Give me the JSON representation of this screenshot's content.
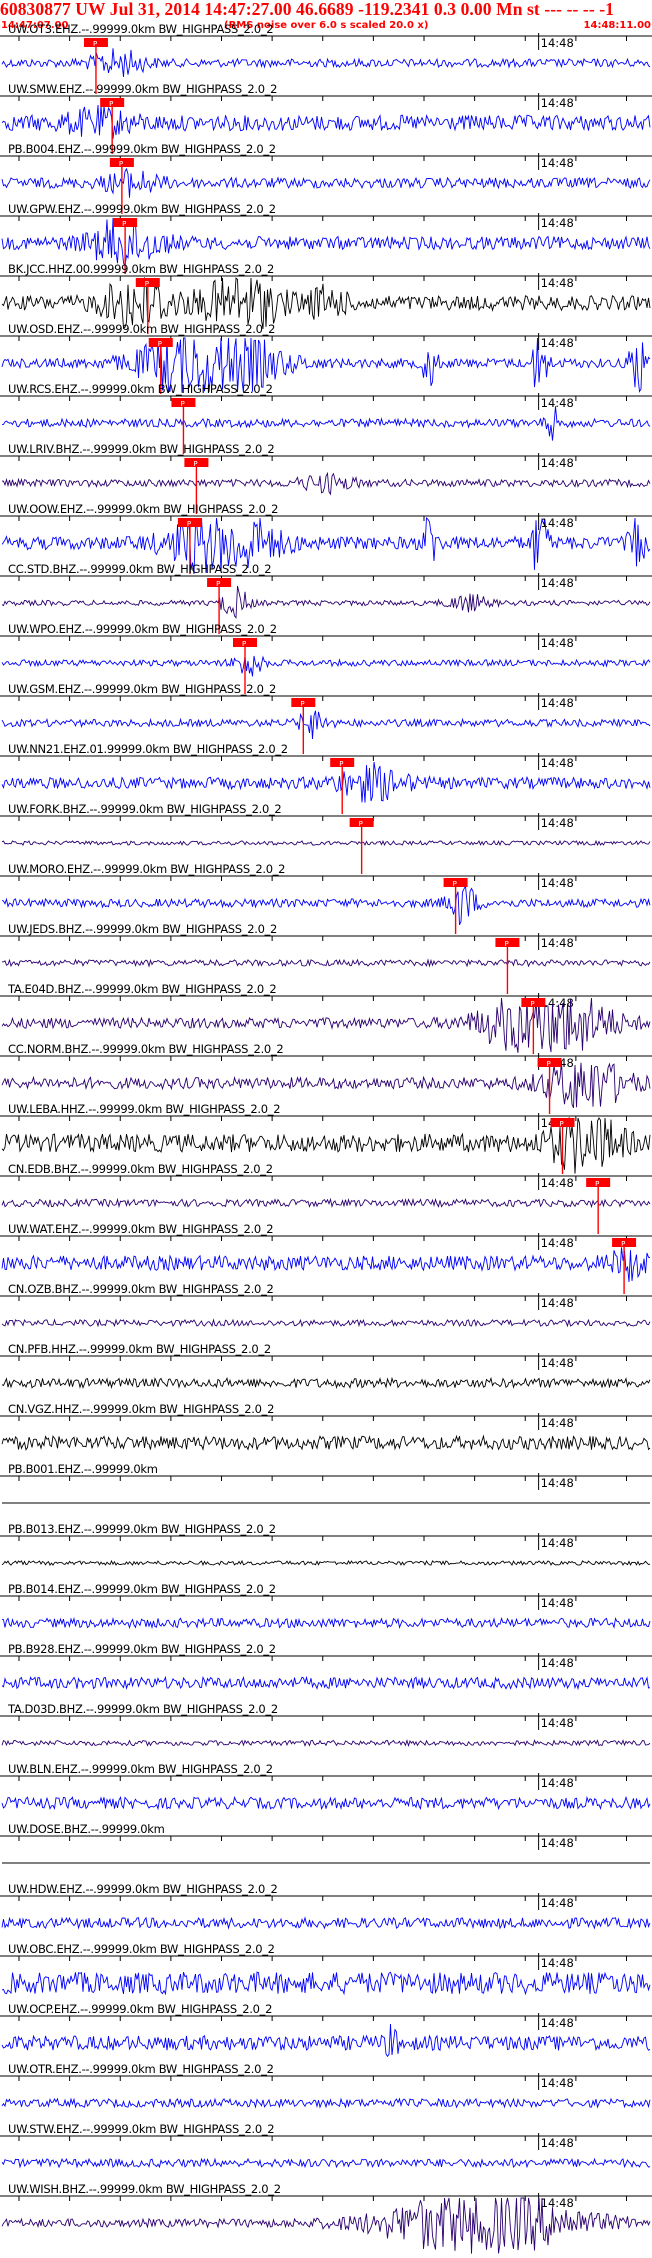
{
  "header": {
    "title": "60830877 UW Jul 31, 2014 14:47:27.00   46.6689 -119.2341  0.3 0.00 Mn st --- -- --  -1",
    "start_time": "14:47:07.00",
    "rms_note": "(RMS noise over 6.0 s scaled 20.0 x)",
    "end_time": "14:48:11.00"
  },
  "colors": {
    "header": "#ff0000",
    "pick": "#ff0000",
    "axis": "#000000",
    "blue": "#0000ff",
    "purple": "#2b0070",
    "black": "#000000"
  },
  "chart_data": {
    "type": "line",
    "title": "60830877 UW Jul 31, 2014 14:47:27.00   46.6689 -119.2341  0.3 0.00 Mn st --- -- --  -1",
    "x_start": "14:47:07.00",
    "x_end": "14:48:11.00",
    "tick_label": "14:48",
    "pick_label": "P",
    "series": [
      {
        "name": "UW.OT3.EHZ.--.99999.0km BW_HIGHPASS_2.0_2",
        "color": "#0000ff",
        "pick": 0.145,
        "amp": 0.16,
        "bursts": [
          [
            0.18,
            0.04,
            0.45
          ]
        ]
      },
      {
        "name": "UW.SMW.EHZ.--.99999.0km BW_HIGHPASS_2.0_2",
        "color": "#0000ff",
        "pick": 0.17,
        "amp": 0.3,
        "bursts": [
          [
            0.15,
            0.05,
            0.4
          ]
        ]
      },
      {
        "name": "PB.B004.EHZ.--.99999.0km BW_HIGHPASS_2.0_2",
        "color": "#0000ff",
        "pick": 0.185,
        "amp": 0.2,
        "bursts": [
          [
            0.2,
            0.04,
            0.4
          ]
        ]
      },
      {
        "name": "UW.GPW.EHZ.--.99999.0km BW_HIGHPASS_2.0_2",
        "color": "#0000ff",
        "pick": 0.19,
        "amp": 0.25,
        "bursts": [
          [
            0.19,
            0.05,
            0.9
          ]
        ]
      },
      {
        "name": "BK.JCC.HHZ.00.99999.0km BW_HIGHPASS_2.0_2",
        "color": "#000000",
        "pick": 0.225,
        "amp": 0.28,
        "bursts": [
          [
            0.21,
            0.05,
            1.0
          ],
          [
            0.37,
            0.06,
            1.0
          ],
          [
            0.5,
            0.03,
            0.5
          ]
        ]
      },
      {
        "name": "UW.OSD.EHZ.--.99999.0km BW_HIGHPASS_2.0_2",
        "color": "#0000ff",
        "pick": 0.245,
        "amp": 0.18,
        "bursts": [
          [
            0.32,
            0.09,
            1.8
          ],
          [
            0.66,
            0.01,
            1.0
          ],
          [
            0.83,
            0.01,
            1.8
          ],
          [
            0.98,
            0.01,
            1.8
          ]
        ]
      },
      {
        "name": "UW.RCS.EHZ.--.99999.0km BW_HIGHPASS_2.0_2",
        "color": "#0000ff",
        "pick": 0.28,
        "amp": 0.16,
        "bursts": [
          [
            0.85,
            0.01,
            0.6
          ]
        ]
      },
      {
        "name": "UW.LRIV.BHZ.--.99999.0km BW_HIGHPASS_2.0_2",
        "color": "#2b0070",
        "pick": 0.3,
        "amp": 0.14,
        "bursts": [
          [
            0.5,
            0.04,
            0.3
          ]
        ]
      },
      {
        "name": "UW.OOW.EHZ.--.99999.0km BW_HIGHPASS_2.0_2",
        "color": "#0000ff",
        "pick": 0.29,
        "amp": 0.25,
        "bursts": [
          [
            0.34,
            0.07,
            1.6
          ],
          [
            0.66,
            0.01,
            1.2
          ],
          [
            0.83,
            0.01,
            1.8
          ],
          [
            0.98,
            0.01,
            1.5
          ]
        ]
      },
      {
        "name": "CC.STD.BHZ.--.99999.0km BW_HIGHPASS_2.0_2",
        "color": "#2b0070",
        "pick": 0.335,
        "amp": 0.1,
        "bursts": [
          [
            0.36,
            0.02,
            0.6
          ],
          [
            0.72,
            0.03,
            0.3
          ]
        ]
      },
      {
        "name": "UW.WPO.EHZ.--.99999.0km BW_HIGHPASS_2.0_2",
        "color": "#0000ff",
        "pick": 0.375,
        "amp": 0.12,
        "bursts": [
          [
            0.38,
            0.02,
            0.5
          ]
        ]
      },
      {
        "name": "UW.GSM.EHZ.--.99999.0km BW_HIGHPASS_2.0_2",
        "color": "#0000ff",
        "pick": 0.465,
        "amp": 0.14,
        "bursts": [
          [
            0.48,
            0.02,
            0.5
          ]
        ]
      },
      {
        "name": "UW.NN21.EHZ.01.99999.0km BW_HIGHPASS_2.0_2",
        "color": "#0000ff",
        "pick": 0.525,
        "amp": 0.22,
        "bursts": [
          [
            0.57,
            0.05,
            0.6
          ]
        ]
      },
      {
        "name": "UW.FORK.BHZ.--.99999.0km BW_HIGHPASS_2.0_2",
        "color": "#2b0070",
        "pick": 0.555,
        "amp": 0.08,
        "bursts": []
      },
      {
        "name": "UW.MORO.EHZ.--.99999.0km BW_HIGHPASS_2.0_2",
        "color": "#0000ff",
        "pick": 0.7,
        "amp": 0.16,
        "bursts": [
          [
            0.71,
            0.02,
            0.8
          ]
        ]
      },
      {
        "name": "UW.JEDS.BHZ.--.99999.0km BW_HIGHPASS_2.0_2",
        "color": "#2b0070",
        "pick": 0.78,
        "amp": 0.12,
        "bursts": []
      },
      {
        "name": "TA.E04D.BHZ.--.99999.0km BW_HIGHPASS_2.0_2",
        "color": "#2b0070",
        "pick": 0.82,
        "amp": 0.2,
        "bursts": [
          [
            0.84,
            0.08,
            2.0
          ]
        ]
      },
      {
        "name": "CC.NORM.BHZ.--.99999.0km BW_HIGHPASS_2.0_2",
        "color": "#2b0070",
        "pick": 0.845,
        "amp": 0.22,
        "bursts": [
          [
            0.9,
            0.06,
            1.0
          ]
        ]
      },
      {
        "name": "UW.LEBA.HHZ.--.99999.0km BW_HIGHPASS_2.0_2",
        "color": "#000000",
        "pick": 0.865,
        "amp": 0.35,
        "bursts": [
          [
            0.9,
            0.05,
            1.1
          ]
        ]
      },
      {
        "name": "CN.EDB.BHZ.--.99999.0km BW_HIGHPASS_2.0_2",
        "color": "#2b0070",
        "pick": 0.92,
        "amp": 0.14,
        "bursts": []
      },
      {
        "name": "UW.WAT.EHZ.--.99999.0km BW_HIGHPASS_2.0_2",
        "color": "#0000ff",
        "pick": 0.96,
        "amp": 0.28,
        "bursts": [
          [
            0.97,
            0.03,
            0.5
          ]
        ]
      },
      {
        "name": "CN.OZB.BHZ.--.99999.0km BW_HIGHPASS_2.0_2",
        "color": "#2b0070",
        "pick": null,
        "amp": 0.12,
        "bursts": []
      },
      {
        "name": "CN.PFB.HHZ.--.99999.0km BW_HIGHPASS_2.0_2",
        "color": "#000000",
        "pick": null,
        "amp": 0.18,
        "bursts": []
      },
      {
        "name": "CN.VGZ.HHZ.--.99999.0km BW_HIGHPASS_2.0_2",
        "color": "#000000",
        "pick": null,
        "amp": 0.26,
        "bursts": []
      },
      {
        "name": "PB.B001.EHZ.--.99999.0km",
        "color": "#000000",
        "pick": null,
        "amp": 0,
        "bursts": []
      },
      {
        "name": "PB.B013.EHZ.--.99999.0km BW_HIGHPASS_2.0_2",
        "color": "#000000",
        "pick": null,
        "amp": 0.08,
        "bursts": []
      },
      {
        "name": "PB.B014.EHZ.--.99999.0km BW_HIGHPASS_2.0_2",
        "color": "#0000ff",
        "pick": null,
        "amp": 0.18,
        "bursts": []
      },
      {
        "name": "PB.B928.EHZ.--.99999.0km BW_HIGHPASS_2.0_2",
        "color": "#0000ff",
        "pick": null,
        "amp": 0.22,
        "bursts": []
      },
      {
        "name": "TA.D03D.BHZ.--.99999.0km BW_HIGHPASS_2.0_2",
        "color": "#2b0070",
        "pick": null,
        "amp": 0.1,
        "bursts": []
      },
      {
        "name": "UW.BLN.EHZ.--.99999.0km BW_HIGHPASS_2.0_2",
        "color": "#0000ff",
        "pick": null,
        "amp": 0.22,
        "bursts": []
      },
      {
        "name": "UW.DOSE.BHZ.--.99999.0km",
        "color": "#000000",
        "pick": null,
        "amp": 0,
        "bursts": []
      },
      {
        "name": "UW.HDW.EHZ.--.99999.0km BW_HIGHPASS_2.0_2",
        "color": "#0000ff",
        "pick": null,
        "amp": 0.2,
        "bursts": []
      },
      {
        "name": "UW.OBC.EHZ.--.99999.0km BW_HIGHPASS_2.0_2",
        "color": "#0000ff",
        "pick": null,
        "amp": 0.42,
        "bursts": []
      },
      {
        "name": "UW.OCP.EHZ.--.99999.0km BW_HIGHPASS_2.0_2",
        "color": "#0000ff",
        "pick": null,
        "amp": 0.28,
        "bursts": [
          [
            0.6,
            0.01,
            0.5
          ]
        ]
      },
      {
        "name": "UW.OTR.EHZ.--.99999.0km BW_HIGHPASS_2.0_2",
        "color": "#0000ff",
        "pick": null,
        "amp": 0.16,
        "bursts": []
      },
      {
        "name": "UW.STW.EHZ.--.99999.0km BW_HIGHPASS_2.0_2",
        "color": "#0000ff",
        "pick": null,
        "amp": 0.16,
        "bursts": []
      },
      {
        "name": "UW.WISH.BHZ.--.99999.0km BW_HIGHPASS_2.0_2",
        "color": "#2b0070",
        "pick": null,
        "amp": 0.16,
        "bursts": [
          [
            0.74,
            0.14,
            1.3
          ]
        ]
      }
    ]
  }
}
